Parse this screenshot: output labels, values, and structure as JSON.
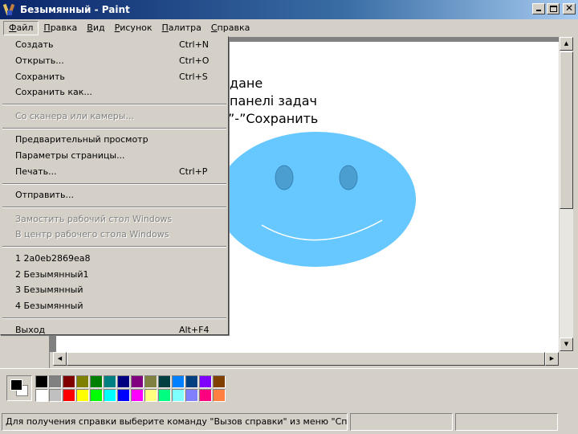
{
  "window": {
    "title": "Безымянный - Paint"
  },
  "menubar": {
    "items": [
      {
        "label": "Файл",
        "active": true
      },
      {
        "label": "Правка",
        "active": false
      },
      {
        "label": "Вид",
        "active": false
      },
      {
        "label": "Рисунок",
        "active": false
      },
      {
        "label": "Палитра",
        "active": false
      },
      {
        "label": "Справка",
        "active": false
      }
    ]
  },
  "file_menu": {
    "entries": [
      {
        "type": "item",
        "label": "Создать",
        "shortcut": "Ctrl+N",
        "enabled": true
      },
      {
        "type": "item",
        "label": "Открыть...",
        "shortcut": "Ctrl+O",
        "enabled": true
      },
      {
        "type": "item",
        "label": "Сохранить",
        "shortcut": "Ctrl+S",
        "enabled": true
      },
      {
        "type": "item",
        "label": "Сохранить как...",
        "shortcut": "",
        "enabled": true
      },
      {
        "type": "separator"
      },
      {
        "type": "item",
        "label": "Со сканера или камеры...",
        "shortcut": "",
        "enabled": false
      },
      {
        "type": "separator"
      },
      {
        "type": "item",
        "label": "Предварительный просмотр",
        "shortcut": "",
        "enabled": true
      },
      {
        "type": "item",
        "label": "Параметры страницы...",
        "shortcut": "",
        "enabled": true
      },
      {
        "type": "item",
        "label": "Печать...",
        "shortcut": "Ctrl+P",
        "enabled": true
      },
      {
        "type": "separator"
      },
      {
        "type": "item",
        "label": "Отправить...",
        "shortcut": "",
        "enabled": true
      },
      {
        "type": "separator"
      },
      {
        "type": "item",
        "label": "Замостить рабочий стол Windows",
        "shortcut": "",
        "enabled": false
      },
      {
        "type": "item",
        "label": "В центр рабочего стола Windows",
        "shortcut": "",
        "enabled": false
      },
      {
        "type": "separator"
      },
      {
        "type": "item",
        "label": "1 2a0eb2869ea8",
        "shortcut": "",
        "enabled": true
      },
      {
        "type": "item",
        "label": "2 Безымянный1",
        "shortcut": "",
        "enabled": true
      },
      {
        "type": "item",
        "label": "3 Безымянный",
        "shortcut": "",
        "enabled": true
      },
      {
        "type": "item",
        "label": "4 Безымянный",
        "shortcut": "",
        "enabled": true
      },
      {
        "type": "separator"
      },
      {
        "type": "item",
        "label": "Выход",
        "shortcut": "Alt+F4",
        "enabled": true
      }
    ]
  },
  "canvas": {
    "text_lines": [
      "дане",
      "панелі задач",
      "”-”Сохранить"
    ],
    "smiley": {
      "face_color": "#66c8ff",
      "eye_color": "#4a9fd0"
    }
  },
  "palette": {
    "foreground": "#000000",
    "background": "#ffffff",
    "top_row": [
      "#000000",
      "#808080",
      "#800000",
      "#808000",
      "#008000",
      "#008080",
      "#000080",
      "#800080",
      "#808040",
      "#004040",
      "#0080ff",
      "#004080",
      "#8000ff",
      "#804000"
    ],
    "bottom_row": [
      "#ffffff",
      "#c0c0c0",
      "#ff0000",
      "#ffff00",
      "#00ff00",
      "#00ffff",
      "#0000ff",
      "#ff00ff",
      "#ffff80",
      "#00ff80",
      "#80ffff",
      "#8080ff",
      "#ff0080",
      "#ff8040"
    ]
  },
  "statusbar": {
    "help_text": "Для получения справки выберите команду \"Вызов справки\" из меню \"Справка\"."
  }
}
